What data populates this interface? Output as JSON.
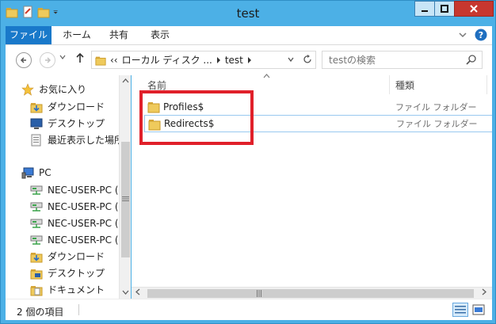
{
  "window": {
    "title": "test",
    "buttons": {
      "minimize": "minimize",
      "maximize": "maximize",
      "close": "close"
    }
  },
  "ribbon": {
    "tabs": [
      {
        "label": "ファイル",
        "active": true
      },
      {
        "label": "ホーム"
      },
      {
        "label": "共有"
      },
      {
        "label": "表示"
      }
    ]
  },
  "address": {
    "overflow": "‹‹",
    "crumbs": [
      "ローカル ディスク ...",
      "test"
    ],
    "search_placeholder": "testの検索"
  },
  "navpane": {
    "items": [
      {
        "label": "お気に入り",
        "icon": "star-icon"
      },
      {
        "label": "ダウンロード",
        "icon": "download-folder-icon"
      },
      {
        "label": "デスクトップ",
        "icon": "desktop-icon"
      },
      {
        "label": "最近表示した場所",
        "icon": "recent-places-icon"
      },
      {
        "label": "PC",
        "icon": "computer-icon"
      },
      {
        "label": "NEC-USER-PC (",
        "icon": "network-drive-icon"
      },
      {
        "label": "NEC-USER-PC (",
        "icon": "network-drive-icon"
      },
      {
        "label": "NEC-USER-PC (",
        "icon": "network-drive-icon"
      },
      {
        "label": "NEC-USER-PC (",
        "icon": "network-drive-icon"
      },
      {
        "label": "ダウンロード",
        "icon": "download-folder-icon"
      },
      {
        "label": "デスクトップ",
        "icon": "desktop-folder-icon"
      },
      {
        "label": "ドキュメント",
        "icon": "documents-folder-icon"
      }
    ]
  },
  "filelist": {
    "columns": {
      "name": "名前",
      "type": "種類"
    },
    "rows": [
      {
        "name": "Profiles$",
        "type": "ファイル フォルダー"
      },
      {
        "name": "Redirects$",
        "type": "ファイル フォルダー"
      }
    ]
  },
  "statusbar": {
    "item_count": "2 個の項目"
  },
  "colors": {
    "window_border": "#4cb0e6",
    "file_tab": "#1979ca",
    "highlight_box": "#e0202a",
    "selection": "#99c9ef",
    "folder": "#e8c25a"
  }
}
